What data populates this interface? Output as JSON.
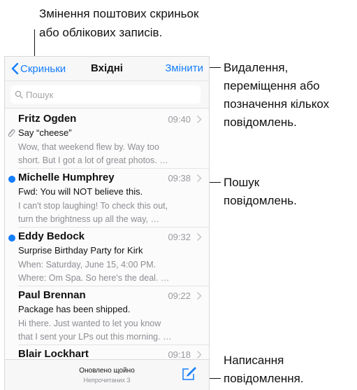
{
  "callouts": {
    "top": [
      "Змінення поштових скриньок",
      "або облікових записів."
    ],
    "edit": [
      "Видалення,",
      "переміщення або",
      "позначення кількох",
      "повідомлень."
    ],
    "search": [
      "Пошук",
      "повідомлень."
    ],
    "compose": [
      "Написання",
      "повідомлення."
    ]
  },
  "nav": {
    "back_label": "Скриньки",
    "title": "Вхідні",
    "edit_label": "Змінити"
  },
  "search": {
    "placeholder": "Пошук"
  },
  "messages": [
    {
      "sender": "Fritz Ogden",
      "time": "09:40",
      "subject": "Say “cheese”",
      "preview": [
        "Wow, that weekend flew by. Way too",
        "short. But I got a lot of great photos. …"
      ],
      "unread": false,
      "attachment": true
    },
    {
      "sender": "Michelle Humphrey",
      "time": "09:38",
      "subject": "Fwd: You will NOT believe this.",
      "preview": [
        "I can't stop laughing! To check this out,",
        "turn the brightness up all the way, …"
      ],
      "unread": true,
      "attachment": false
    },
    {
      "sender": "Eddy Bedock",
      "time": "09:32",
      "subject": "Surprise Birthday Party for Kirk",
      "preview": [
        "When: Saturday, June 15, 4:00 PM.",
        "Where: Om Spa. So here's the deal. …"
      ],
      "unread": true,
      "attachment": false
    },
    {
      "sender": "Paul Brennan",
      "time": "09:22",
      "subject": "Package has been shipped.",
      "preview": [
        "Hi there. Just wanted to let you know",
        "that I sent your LPs out this morning. …"
      ],
      "unread": false,
      "attachment": false
    },
    {
      "sender": "Blair Lockhart",
      "time": "09:18",
      "subject": "",
      "preview": [],
      "unread": false,
      "attachment": false
    }
  ],
  "toolbar": {
    "status": "Оновлено щойно",
    "unread": "Непрочитаних 3"
  },
  "colors": {
    "accent": "#147efb",
    "unread_dot": "#147efb"
  }
}
